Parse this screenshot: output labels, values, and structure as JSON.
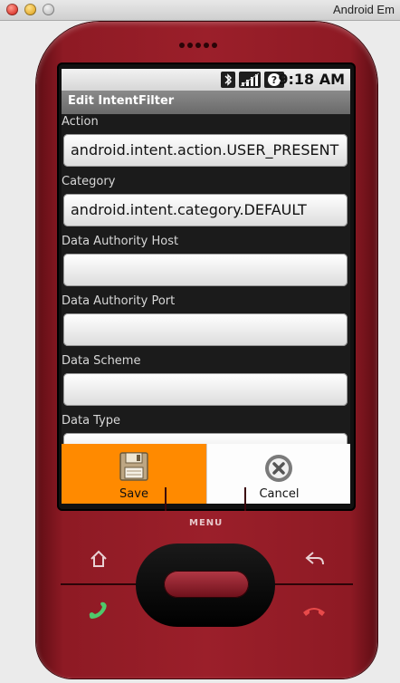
{
  "window": {
    "title": "Android Em"
  },
  "status_bar": {
    "time": "9:18 AM",
    "icons": [
      "bluetooth-icon",
      "signal-icon",
      "help-icon"
    ]
  },
  "app": {
    "title": "Edit IntentFilter"
  },
  "form": {
    "fields": [
      {
        "label": "Action",
        "value": "android.intent.action.USER_PRESENT"
      },
      {
        "label": "Category",
        "value": "android.intent.category.DEFAULT"
      },
      {
        "label": "Data Authority Host",
        "value": ""
      },
      {
        "label": "Data Authority Port",
        "value": ""
      },
      {
        "label": "Data Scheme",
        "value": ""
      },
      {
        "label": "Data Type",
        "value": ""
      }
    ]
  },
  "buttons": {
    "save": "Save",
    "cancel": "Cancel"
  },
  "device": {
    "menu_label": "MENU"
  },
  "colors": {
    "accent": "#ff8a00",
    "phone_body": "#9b1f2a"
  }
}
